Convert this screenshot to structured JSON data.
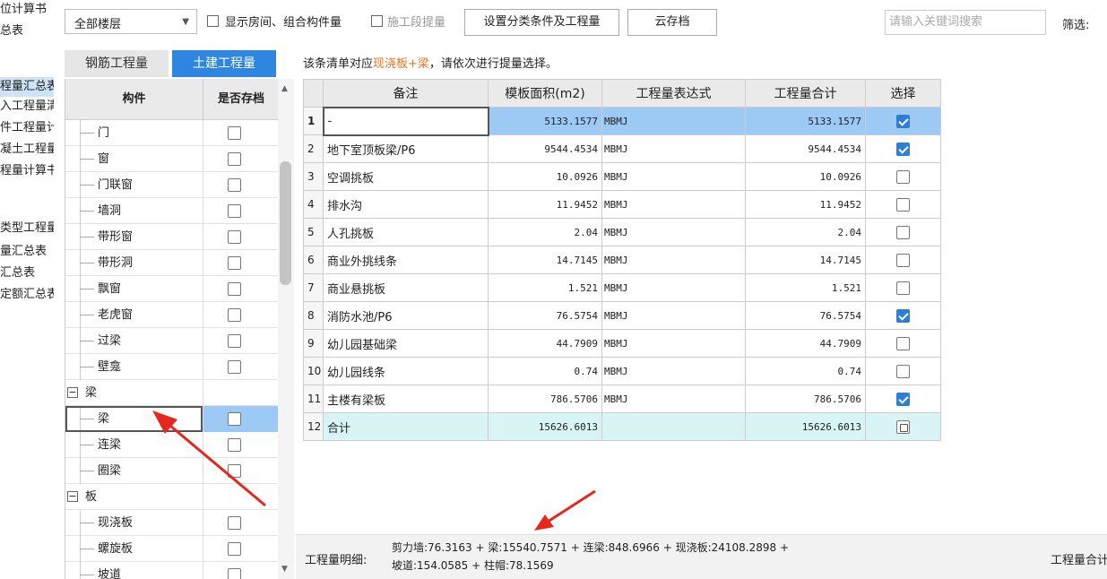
{
  "left_nav": {
    "items": [
      {
        "label": "位计算书",
        "selected": false
      },
      {
        "label": "总表",
        "selected": false
      },
      {
        "label": "程量汇总表",
        "selected": true
      },
      {
        "label": "入工程量清",
        "selected": false
      },
      {
        "label": "件工程量计",
        "selected": false
      },
      {
        "label": "凝土工程量",
        "selected": false
      },
      {
        "label": "程量计算书",
        "selected": false
      },
      {
        "label": "类型工程量",
        "selected": false
      },
      {
        "label": "量汇总表",
        "selected": false
      },
      {
        "label": "汇总表",
        "selected": false
      },
      {
        "label": "定额汇总表",
        "selected": false
      }
    ]
  },
  "toolbar": {
    "floor_select": "全部楼层",
    "show_rooms_label": "显示房间、组合构件量",
    "stage_label": "施工段提量",
    "set_condition_button": "设置分类条件及工程量",
    "cloud_save_button": "云存档",
    "search_placeholder": "请输入关键词搜索",
    "filter_label": "筛选:"
  },
  "tabs": [
    {
      "label": "钢筋工程量",
      "active": false
    },
    {
      "label": "土建工程量",
      "active": true
    }
  ],
  "tree": {
    "col_component": "构件",
    "col_saved": "是否存档",
    "rows": [
      {
        "label": "门",
        "type": "child"
      },
      {
        "label": "窗",
        "type": "child"
      },
      {
        "label": "门联窗",
        "type": "child"
      },
      {
        "label": "墙洞",
        "type": "child"
      },
      {
        "label": "带形窗",
        "type": "child"
      },
      {
        "label": "带形洞",
        "type": "child"
      },
      {
        "label": "飘窗",
        "type": "child"
      },
      {
        "label": "老虎窗",
        "type": "child"
      },
      {
        "label": "过梁",
        "type": "child"
      },
      {
        "label": "壁龛",
        "type": "child"
      },
      {
        "label": "梁",
        "type": "group"
      },
      {
        "label": "梁",
        "type": "child",
        "selected": true
      },
      {
        "label": "连梁",
        "type": "child"
      },
      {
        "label": "圈梁",
        "type": "child"
      },
      {
        "label": "板",
        "type": "group"
      },
      {
        "label": "现浇板",
        "type": "child"
      },
      {
        "label": "螺旋板",
        "type": "child"
      },
      {
        "label": "坡道",
        "type": "child"
      }
    ]
  },
  "message": {
    "prefix": "该条清单对应",
    "highlight": "现浇板+梁",
    "suffix": "，请依次进行提量选择。",
    "highlight_color": "#e8731c"
  },
  "grid": {
    "headers": [
      "备注",
      "模板面积(m2)",
      "工程量表达式",
      "工程量合计",
      "选择"
    ],
    "rows": [
      {
        "no": "1",
        "remark": "-",
        "area": "5133.1577",
        "expr": "MBMJ",
        "total": "5133.1577",
        "checked": true
      },
      {
        "no": "2",
        "remark": "地下室顶板梁/P6",
        "area": "9544.4534",
        "expr": "MBMJ",
        "total": "9544.4534",
        "checked": true
      },
      {
        "no": "3",
        "remark": "空调挑板",
        "area": "10.0926",
        "expr": "MBMJ",
        "total": "10.0926",
        "checked": false
      },
      {
        "no": "4",
        "remark": "排水沟",
        "area": "11.9452",
        "expr": "MBMJ",
        "total": "11.9452",
        "checked": false
      },
      {
        "no": "5",
        "remark": "人孔挑板",
        "area": "2.04",
        "expr": "MBMJ",
        "total": "2.04",
        "checked": false
      },
      {
        "no": "6",
        "remark": "商业外挑线条",
        "area": "14.7145",
        "expr": "MBMJ",
        "total": "14.7145",
        "checked": false
      },
      {
        "no": "7",
        "remark": "商业悬挑板",
        "area": "1.521",
        "expr": "MBMJ",
        "total": "1.521",
        "checked": false
      },
      {
        "no": "8",
        "remark": "消防水池/P6",
        "area": "76.5754",
        "expr": "MBMJ",
        "total": "76.5754",
        "checked": true
      },
      {
        "no": "9",
        "remark": "幼儿园基础梁",
        "area": "44.7909",
        "expr": "MBMJ",
        "total": "44.7909",
        "checked": false
      },
      {
        "no": "10",
        "remark": "幼儿园线条",
        "area": "0.74",
        "expr": "MBMJ",
        "total": "0.74",
        "checked": false
      },
      {
        "no": "11",
        "remark": "主楼有梁板",
        "area": "786.5706",
        "expr": "MBMJ",
        "total": "786.5706",
        "checked": true
      },
      {
        "no": "12",
        "remark": "合计",
        "area": "15626.6013",
        "expr": "",
        "total": "15626.6013",
        "checked": false
      }
    ]
  },
  "bottom": {
    "detail_label": "工程量明细:",
    "detail_line1": "剪力墙:76.3163 + 梁:15540.7571 + 连梁:848.6966 + 现浇板:24108.2898 +",
    "detail_line2": "坡道:154.0585 + 柱帽:78.1569",
    "total_label": "工程量合计"
  },
  "colors": {
    "active_tab": "#2f86e0",
    "selected_row": "#9ccaf5",
    "total_row": "#d8f4f4",
    "annotation_arrow": "#e8271c"
  }
}
